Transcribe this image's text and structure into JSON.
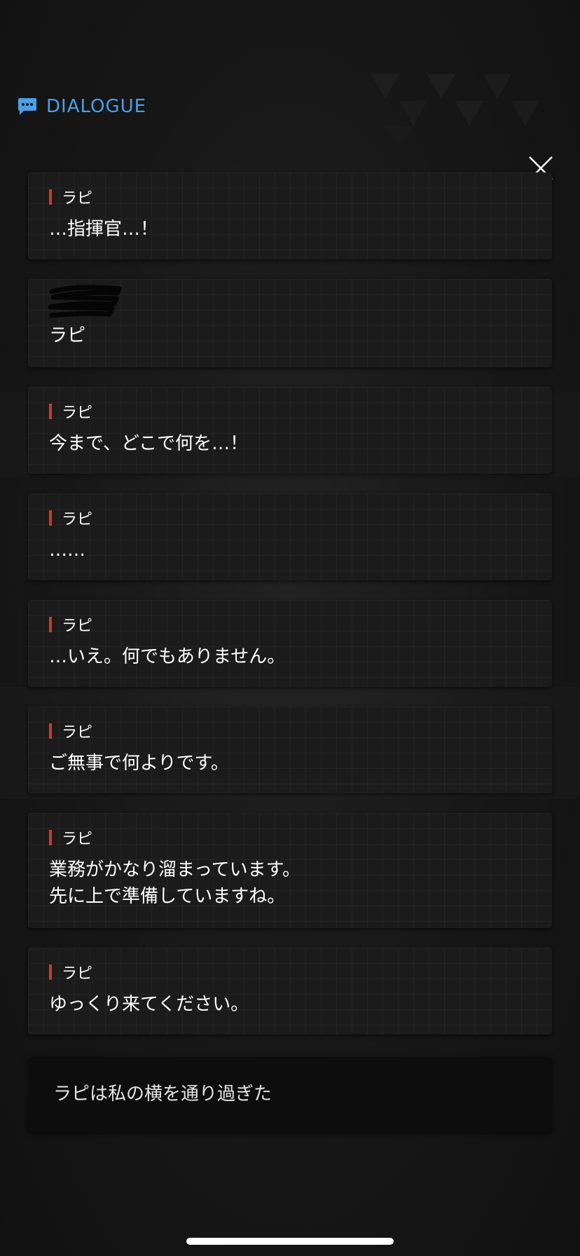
{
  "header": {
    "title": "DIALOGUE",
    "icon": "chat-bubble-icon",
    "accent_color": "#4a9fe8"
  },
  "close": {
    "icon": "close-icon"
  },
  "speaker_color": "#d33a1f",
  "dialogue": [
    {
      "speaker": "ラピ",
      "text": "…指揮官…！"
    },
    {
      "speaker": "",
      "text": "ラピ",
      "scribbled_speaker": true
    },
    {
      "speaker": "ラピ",
      "text": "今まで、どこで何を…！"
    },
    {
      "speaker": "ラピ",
      "text": "……"
    },
    {
      "speaker": "ラピ",
      "text": "…いえ。何でもありません。"
    },
    {
      "speaker": "ラピ",
      "text": "ご無事で何よりです。"
    },
    {
      "speaker": "ラピ",
      "text": "業務がかなり溜まっています。\n先に上で準備していますね。"
    },
    {
      "speaker": "ラピ",
      "text": "ゆっくり来てください。"
    }
  ],
  "narration": {
    "text": "ラピは私の横を通り過ぎた"
  }
}
